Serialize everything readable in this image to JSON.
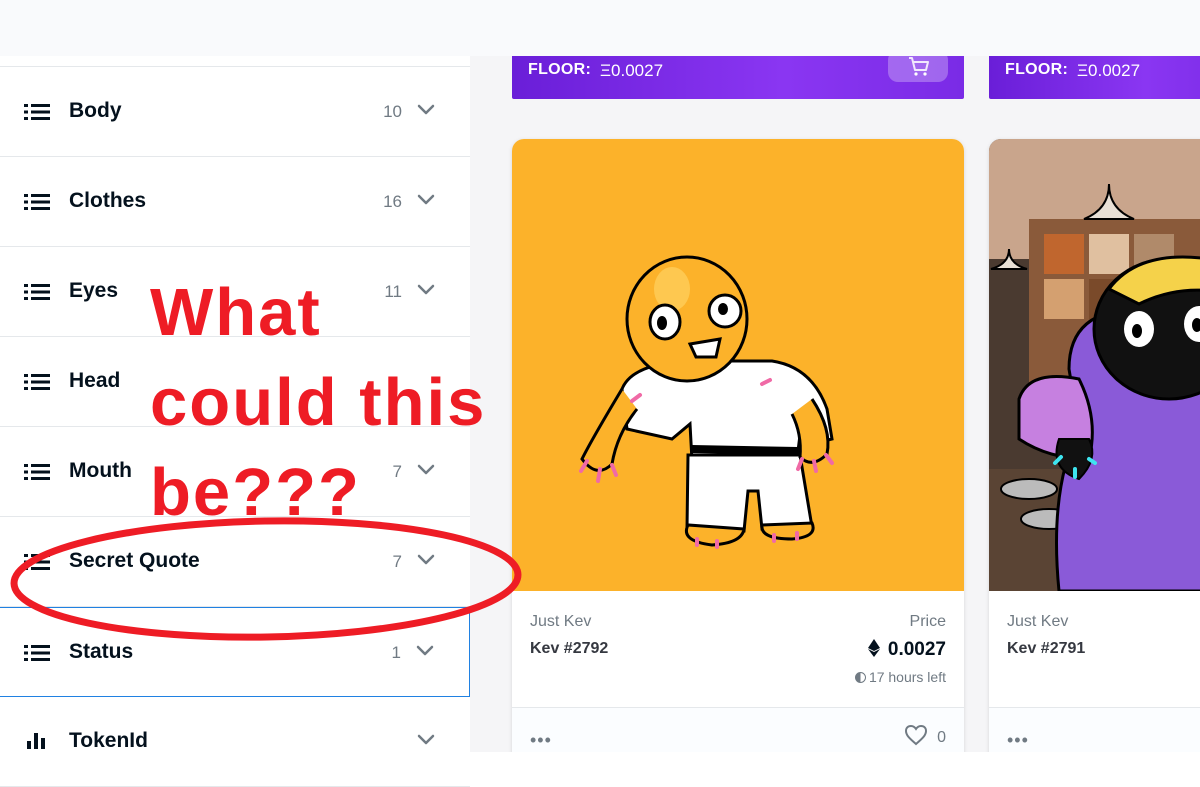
{
  "sidebar": {
    "traits": [
      {
        "label": "Body",
        "count": "10"
      },
      {
        "label": "Clothes",
        "count": "16"
      },
      {
        "label": "Eyes",
        "count": "11"
      },
      {
        "label": "Head",
        "count": ""
      },
      {
        "label": "Mouth",
        "count": "7"
      },
      {
        "label": "Secret Quote",
        "count": "7"
      },
      {
        "label": "Status",
        "count": "1"
      },
      {
        "label": "TokenId",
        "count": ""
      }
    ]
  },
  "banners": [
    {
      "floor_label": "FLOOR:",
      "floor_value": "Ξ0.0027"
    },
    {
      "floor_label": "FLOOR:",
      "floor_value": "Ξ0.0027"
    }
  ],
  "cards": [
    {
      "collection": "Just Kev",
      "name": "Kev #2792",
      "price_label": "Price",
      "price": "0.0027",
      "time_left": "17 hours left",
      "likes": "0",
      "art_bg": "#fcb22a"
    },
    {
      "collection": "Just Kev",
      "name": "Kev #2791",
      "price_label": "",
      "price": "",
      "time_left": "",
      "likes": "",
      "art_bg": "#3a2a22"
    }
  ],
  "annotation": {
    "lines": [
      "What",
      "could  this",
      "be???"
    ],
    "color": "#ee1c25"
  },
  "colors": {
    "accent": "#2081e2",
    "floor_banner": "#7a2be6",
    "text_primary": "#04111d",
    "text_secondary": "#707a83"
  },
  "icons": {
    "trait_icon": "list-icon",
    "expand_icon": "chevron-down-icon",
    "price_icon": "ethereum-icon",
    "cart_icon": "cart-icon",
    "like_icon": "heart-icon",
    "more_icon": "more-horizontal-icon"
  }
}
